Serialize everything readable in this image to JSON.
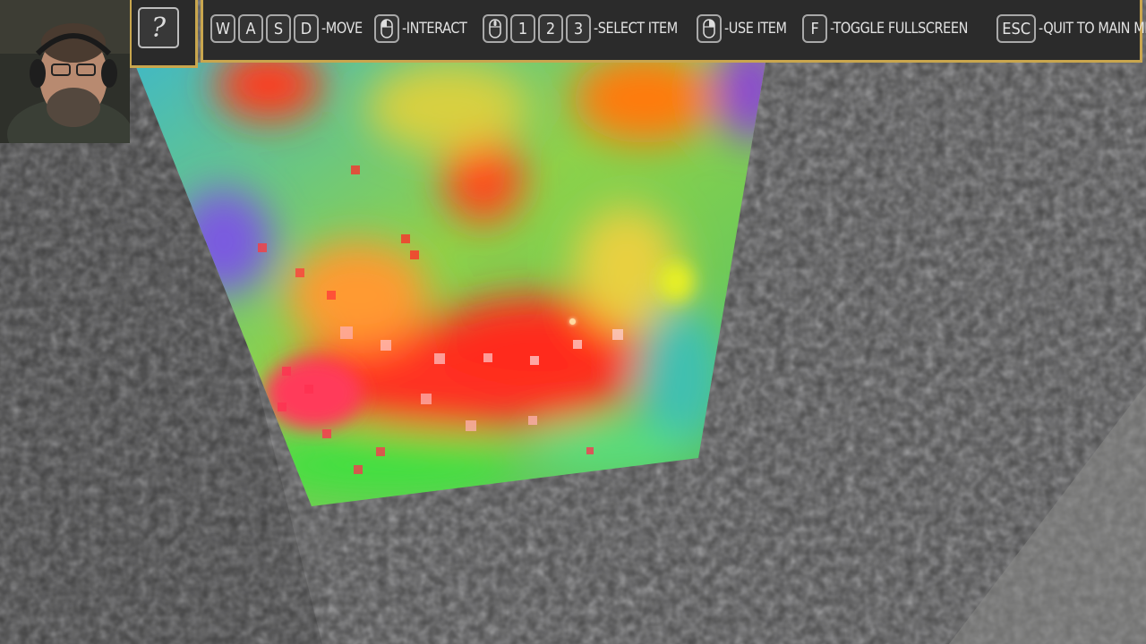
{
  "hud": {
    "help_label": "?",
    "keys": {
      "w": "W",
      "a": "A",
      "s": "S",
      "d": "D",
      "one": "1",
      "two": "2",
      "three": "3",
      "f": "F",
      "esc": "ESC"
    },
    "labels": {
      "move": "-MOVE",
      "interact": "-INTERACT",
      "select_item": "-SELECT ITEM",
      "use_item": "-USE ITEM",
      "toggle_fullscreen": "-TOGGLE FULLSCREEN",
      "quit": "-QUIT TO MAIN MENU"
    },
    "accent_color": "#c9a64e"
  },
  "icons": {
    "left_mouse": "left-mouse-button-icon",
    "scroll_wheel": "mouse-scroll-wheel-icon",
    "right_mouse": "right-mouse-button-icon"
  }
}
